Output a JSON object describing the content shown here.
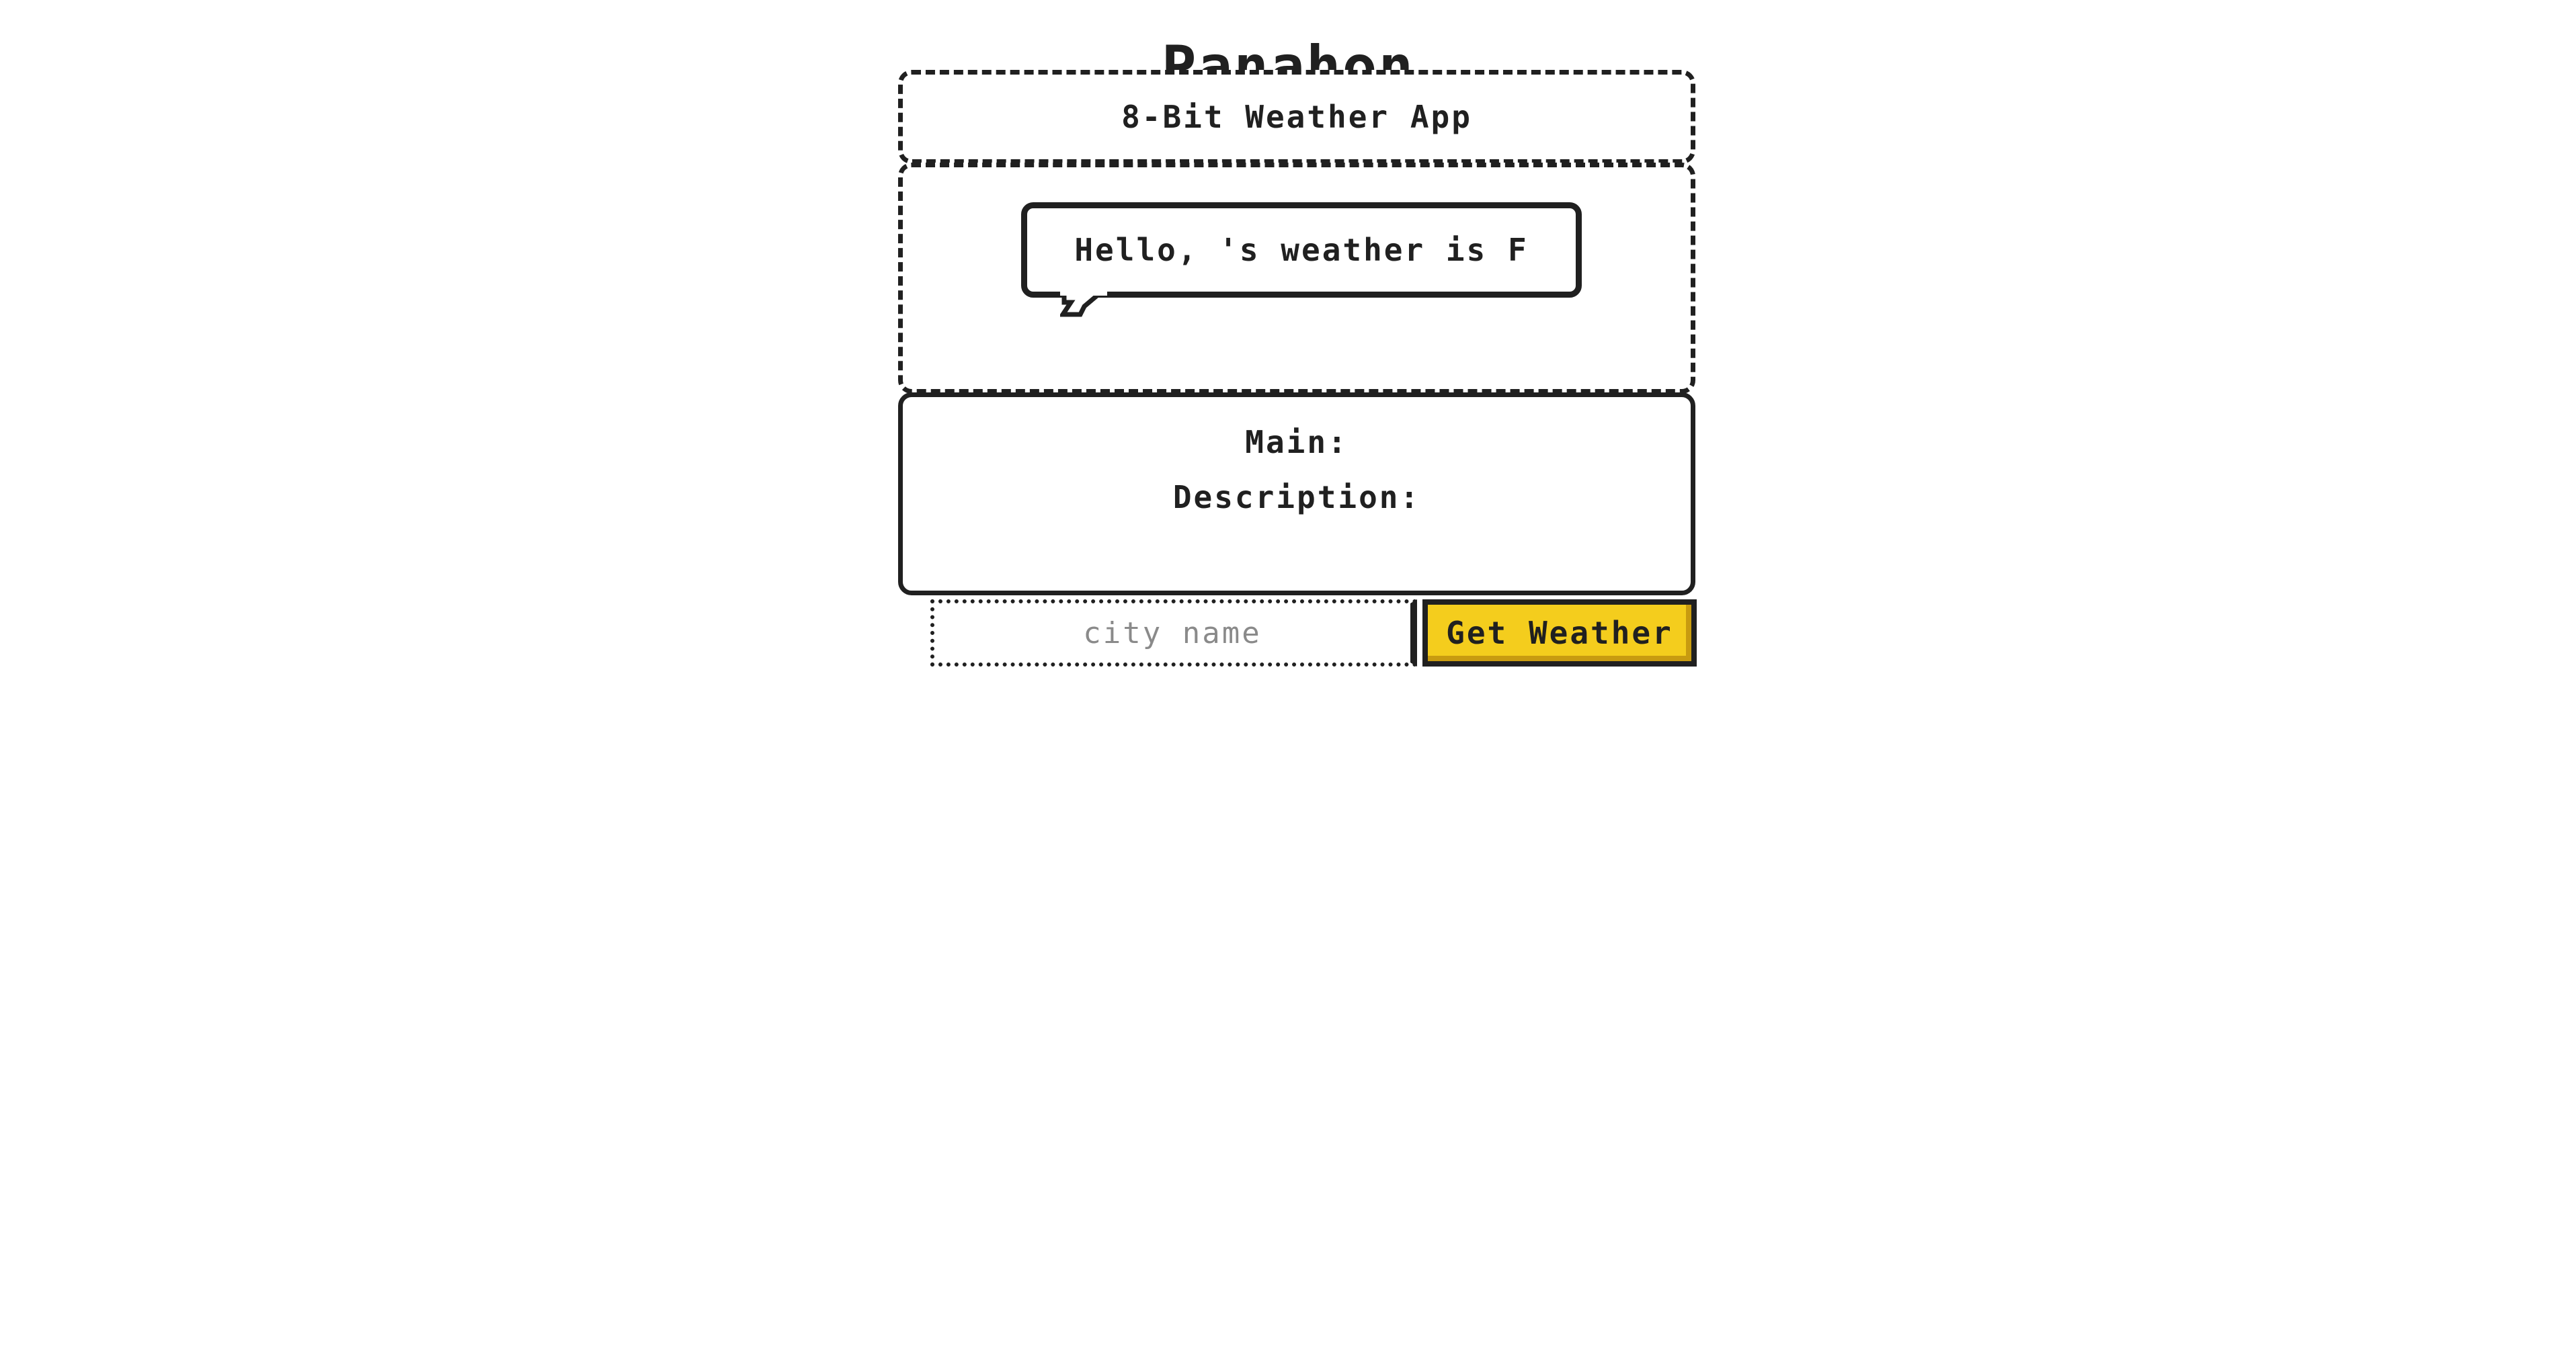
{
  "header": {
    "title": "Panahon"
  },
  "subtitle": {
    "text": "8-Bit Weather App"
  },
  "greeting": {
    "text": "Hello, 's weather is F"
  },
  "details": {
    "main_label": "Main:",
    "description_label": "Description:"
  },
  "search": {
    "placeholder": "city name",
    "value": "",
    "button_label": "Get Weather"
  },
  "colors": {
    "ink": "#202020",
    "button_fill": "#f4cd1d",
    "background": "#ffffff"
  },
  "icons": [
    "speech-bubble-tail-icon"
  ]
}
